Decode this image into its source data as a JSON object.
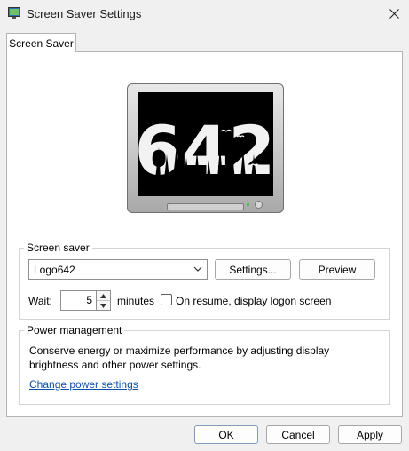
{
  "window": {
    "title": "Screen Saver Settings",
    "icon": "screen-saver-app-icon",
    "close_icon": "close-icon"
  },
  "tabs": [
    {
      "label": "Screen Saver",
      "selected": true
    }
  ],
  "preview": {
    "logo_text": "642",
    "power_led_color": "#35c535"
  },
  "screen_saver_group": {
    "legend": "Screen saver",
    "selected_saver": "Logo642",
    "settings_label": "Settings...",
    "preview_label": "Preview",
    "wait_label": "Wait:",
    "wait_value": "5",
    "minutes_label": "minutes",
    "resume_checkbox_label": "On resume, display logon screen",
    "resume_checked": false
  },
  "power_group": {
    "legend": "Power management",
    "description": "Conserve energy or maximize performance by adjusting display brightness and other power settings.",
    "link_label": "Change power settings",
    "link_color": "#0b4fa8"
  },
  "footer": {
    "ok_label": "OK",
    "cancel_label": "Cancel",
    "apply_label": "Apply"
  }
}
